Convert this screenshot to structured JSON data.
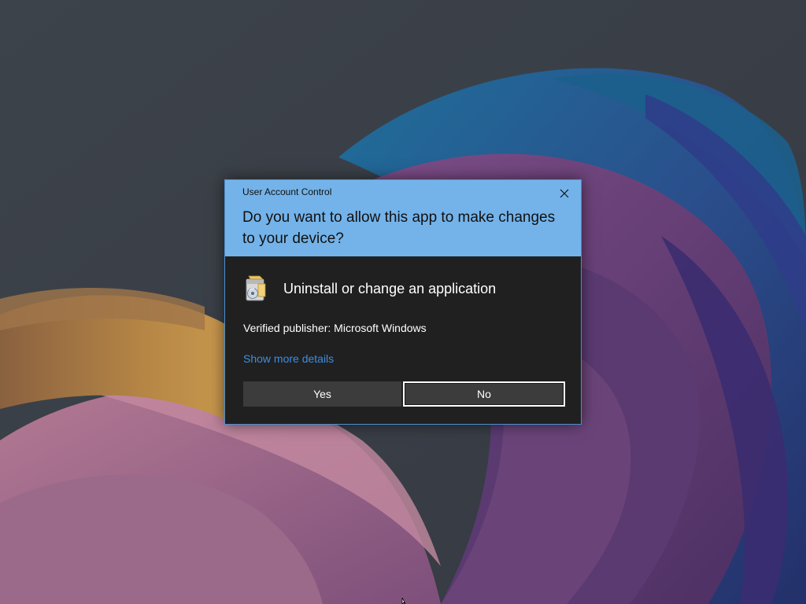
{
  "dialog": {
    "window_title": "User Account Control",
    "question": "Do you want to allow this app to make changes to your device?",
    "app_name": "Uninstall or change an application",
    "publisher": "Verified publisher: Microsoft Windows",
    "details_link": "Show more details",
    "yes_label": "Yes",
    "no_label": "No",
    "close_icon": "close-icon",
    "app_icon": "program-installer-icon",
    "header_color": "#74b3e9",
    "body_color": "#202020",
    "link_color": "#3d8ee0"
  }
}
